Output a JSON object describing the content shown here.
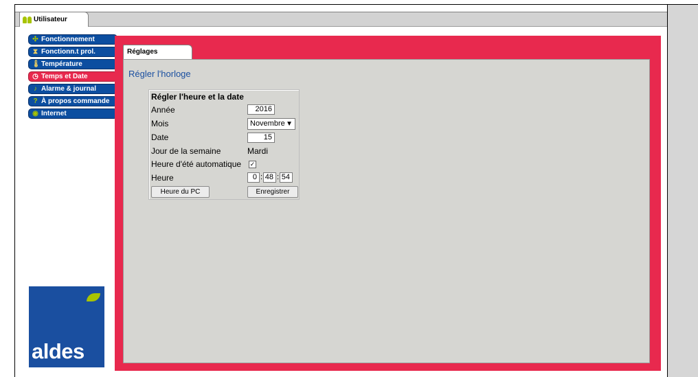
{
  "header": {
    "user_tab_label": "Utilisateur"
  },
  "sidebar": {
    "items": [
      {
        "label": "Fonctionnement",
        "icon": "fan-icon"
      },
      {
        "label": "Fonctionn.t prol.",
        "icon": "hourglass-icon"
      },
      {
        "label": "Température",
        "icon": "thermometer-icon"
      },
      {
        "label": "Temps et Date",
        "icon": "clock-icon",
        "active": true
      },
      {
        "label": "Alarme & journal",
        "icon": "bell-icon"
      },
      {
        "label": "À propos commande",
        "icon": "question-icon"
      },
      {
        "label": "Internet",
        "icon": "globe-icon"
      }
    ]
  },
  "brand": {
    "logo_text": "aldes"
  },
  "panel": {
    "tab_label": "Réglages",
    "page_title": "Régler l'horloge",
    "form": {
      "heading": "Régler l'heure et la date",
      "year_label": "Année",
      "year_value": "2016",
      "month_label": "Mois",
      "month_value": "Novembre",
      "date_label": "Date",
      "date_value": "15",
      "weekday_label": "Jour de la semaine",
      "weekday_value": "Mardi",
      "dst_label": "Heure d'été automatique",
      "dst_checked": "✓",
      "time_label": "Heure",
      "time_hours": "0",
      "time_minutes": "48",
      "time_seconds": "54",
      "time_separator": ":",
      "pc_time_button": "Heure du PC",
      "save_button": "Enregistrer"
    }
  },
  "colors": {
    "accent_red": "#e8294e",
    "nav_blue": "#0c4ea0",
    "brand_green": "#a8c400",
    "panel_gray": "#d6d6d2"
  }
}
